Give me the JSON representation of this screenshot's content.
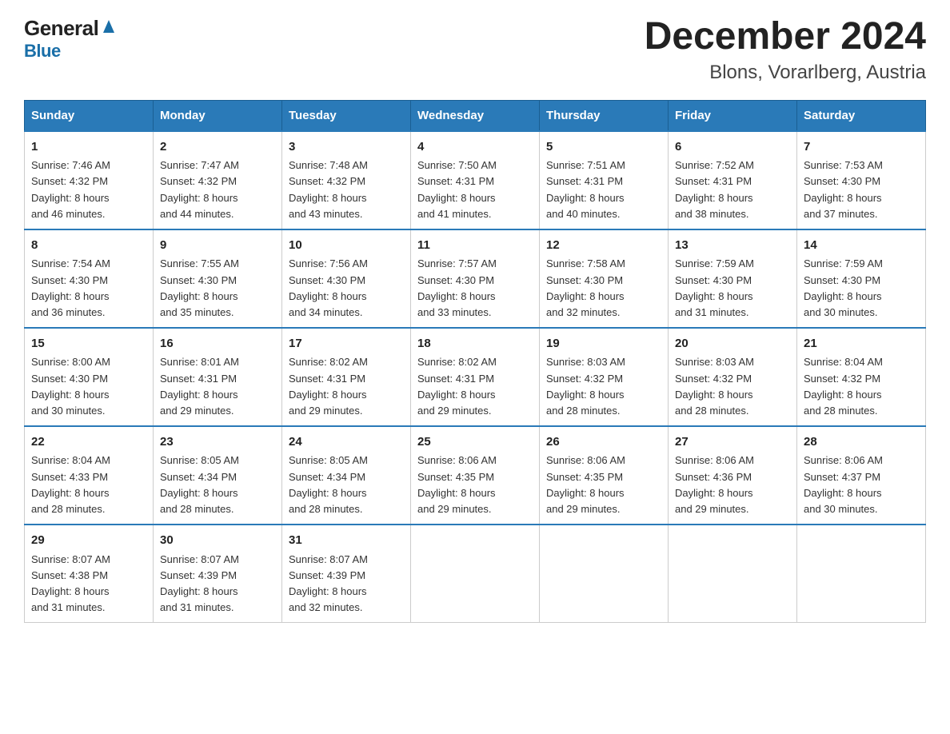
{
  "logo": {
    "line1": "General",
    "line2": "Blue"
  },
  "header": {
    "title": "December 2024",
    "subtitle": "Blons, Vorarlberg, Austria"
  },
  "days_of_week": [
    "Sunday",
    "Monday",
    "Tuesday",
    "Wednesday",
    "Thursday",
    "Friday",
    "Saturday"
  ],
  "weeks": [
    [
      {
        "day": "1",
        "sunrise": "7:46 AM",
        "sunset": "4:32 PM",
        "daylight": "8 hours and 46 minutes."
      },
      {
        "day": "2",
        "sunrise": "7:47 AM",
        "sunset": "4:32 PM",
        "daylight": "8 hours and 44 minutes."
      },
      {
        "day": "3",
        "sunrise": "7:48 AM",
        "sunset": "4:32 PM",
        "daylight": "8 hours and 43 minutes."
      },
      {
        "day": "4",
        "sunrise": "7:50 AM",
        "sunset": "4:31 PM",
        "daylight": "8 hours and 41 minutes."
      },
      {
        "day": "5",
        "sunrise": "7:51 AM",
        "sunset": "4:31 PM",
        "daylight": "8 hours and 40 minutes."
      },
      {
        "day": "6",
        "sunrise": "7:52 AM",
        "sunset": "4:31 PM",
        "daylight": "8 hours and 38 minutes."
      },
      {
        "day": "7",
        "sunrise": "7:53 AM",
        "sunset": "4:30 PM",
        "daylight": "8 hours and 37 minutes."
      }
    ],
    [
      {
        "day": "8",
        "sunrise": "7:54 AM",
        "sunset": "4:30 PM",
        "daylight": "8 hours and 36 minutes."
      },
      {
        "day": "9",
        "sunrise": "7:55 AM",
        "sunset": "4:30 PM",
        "daylight": "8 hours and 35 minutes."
      },
      {
        "day": "10",
        "sunrise": "7:56 AM",
        "sunset": "4:30 PM",
        "daylight": "8 hours and 34 minutes."
      },
      {
        "day": "11",
        "sunrise": "7:57 AM",
        "sunset": "4:30 PM",
        "daylight": "8 hours and 33 minutes."
      },
      {
        "day": "12",
        "sunrise": "7:58 AM",
        "sunset": "4:30 PM",
        "daylight": "8 hours and 32 minutes."
      },
      {
        "day": "13",
        "sunrise": "7:59 AM",
        "sunset": "4:30 PM",
        "daylight": "8 hours and 31 minutes."
      },
      {
        "day": "14",
        "sunrise": "7:59 AM",
        "sunset": "4:30 PM",
        "daylight": "8 hours and 30 minutes."
      }
    ],
    [
      {
        "day": "15",
        "sunrise": "8:00 AM",
        "sunset": "4:30 PM",
        "daylight": "8 hours and 30 minutes."
      },
      {
        "day": "16",
        "sunrise": "8:01 AM",
        "sunset": "4:31 PM",
        "daylight": "8 hours and 29 minutes."
      },
      {
        "day": "17",
        "sunrise": "8:02 AM",
        "sunset": "4:31 PM",
        "daylight": "8 hours and 29 minutes."
      },
      {
        "day": "18",
        "sunrise": "8:02 AM",
        "sunset": "4:31 PM",
        "daylight": "8 hours and 29 minutes."
      },
      {
        "day": "19",
        "sunrise": "8:03 AM",
        "sunset": "4:32 PM",
        "daylight": "8 hours and 28 minutes."
      },
      {
        "day": "20",
        "sunrise": "8:03 AM",
        "sunset": "4:32 PM",
        "daylight": "8 hours and 28 minutes."
      },
      {
        "day": "21",
        "sunrise": "8:04 AM",
        "sunset": "4:32 PM",
        "daylight": "8 hours and 28 minutes."
      }
    ],
    [
      {
        "day": "22",
        "sunrise": "8:04 AM",
        "sunset": "4:33 PM",
        "daylight": "8 hours and 28 minutes."
      },
      {
        "day": "23",
        "sunrise": "8:05 AM",
        "sunset": "4:34 PM",
        "daylight": "8 hours and 28 minutes."
      },
      {
        "day": "24",
        "sunrise": "8:05 AM",
        "sunset": "4:34 PM",
        "daylight": "8 hours and 28 minutes."
      },
      {
        "day": "25",
        "sunrise": "8:06 AM",
        "sunset": "4:35 PM",
        "daylight": "8 hours and 29 minutes."
      },
      {
        "day": "26",
        "sunrise": "8:06 AM",
        "sunset": "4:35 PM",
        "daylight": "8 hours and 29 minutes."
      },
      {
        "day": "27",
        "sunrise": "8:06 AM",
        "sunset": "4:36 PM",
        "daylight": "8 hours and 29 minutes."
      },
      {
        "day": "28",
        "sunrise": "8:06 AM",
        "sunset": "4:37 PM",
        "daylight": "8 hours and 30 minutes."
      }
    ],
    [
      {
        "day": "29",
        "sunrise": "8:07 AM",
        "sunset": "4:38 PM",
        "daylight": "8 hours and 31 minutes."
      },
      {
        "day": "30",
        "sunrise": "8:07 AM",
        "sunset": "4:39 PM",
        "daylight": "8 hours and 31 minutes."
      },
      {
        "day": "31",
        "sunrise": "8:07 AM",
        "sunset": "4:39 PM",
        "daylight": "8 hours and 32 minutes."
      },
      null,
      null,
      null,
      null
    ]
  ],
  "labels": {
    "sunrise": "Sunrise:",
    "sunset": "Sunset:",
    "daylight": "Daylight:"
  }
}
